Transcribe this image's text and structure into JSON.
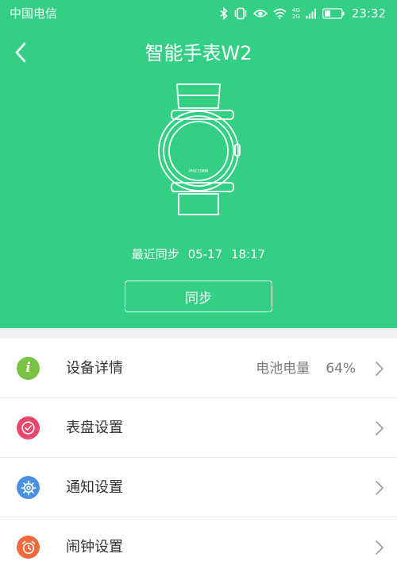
{
  "status_bar": {
    "carrier": "中国电信",
    "network_labels": [
      "4G",
      "2G"
    ],
    "time": "23:32",
    "icons": [
      "bluetooth-icon",
      "vibrate-icon",
      "eye-icon",
      "wifi-icon",
      "signal-icon",
      "battery-icon"
    ]
  },
  "header": {
    "title": "智能手表W2",
    "back_icon": "chevron-left-icon"
  },
  "watch": {
    "brand_text": "PHICOMM"
  },
  "sync": {
    "last_sync_label": "最近同步",
    "last_sync_date": "05-17",
    "last_sync_time": "18:17",
    "button_label": "同步"
  },
  "menu": {
    "items": [
      {
        "label": "设备详情",
        "value_label": "电池电量",
        "value": "64%",
        "icon": "info-icon",
        "icon_color": "#7ac143"
      },
      {
        "label": "表盘设置",
        "icon": "watch-face-icon",
        "icon_color": "#e8486b"
      },
      {
        "label": "通知设置",
        "icon": "gear-icon",
        "icon_color": "#4a90e2"
      },
      {
        "label": "闹钟设置",
        "icon": "alarm-clock-icon",
        "icon_color": "#ef6a3c"
      }
    ]
  },
  "colors": {
    "brand_green": "#33cf85",
    "list_background": "#ffffff",
    "page_background": "#f2f2f2"
  }
}
